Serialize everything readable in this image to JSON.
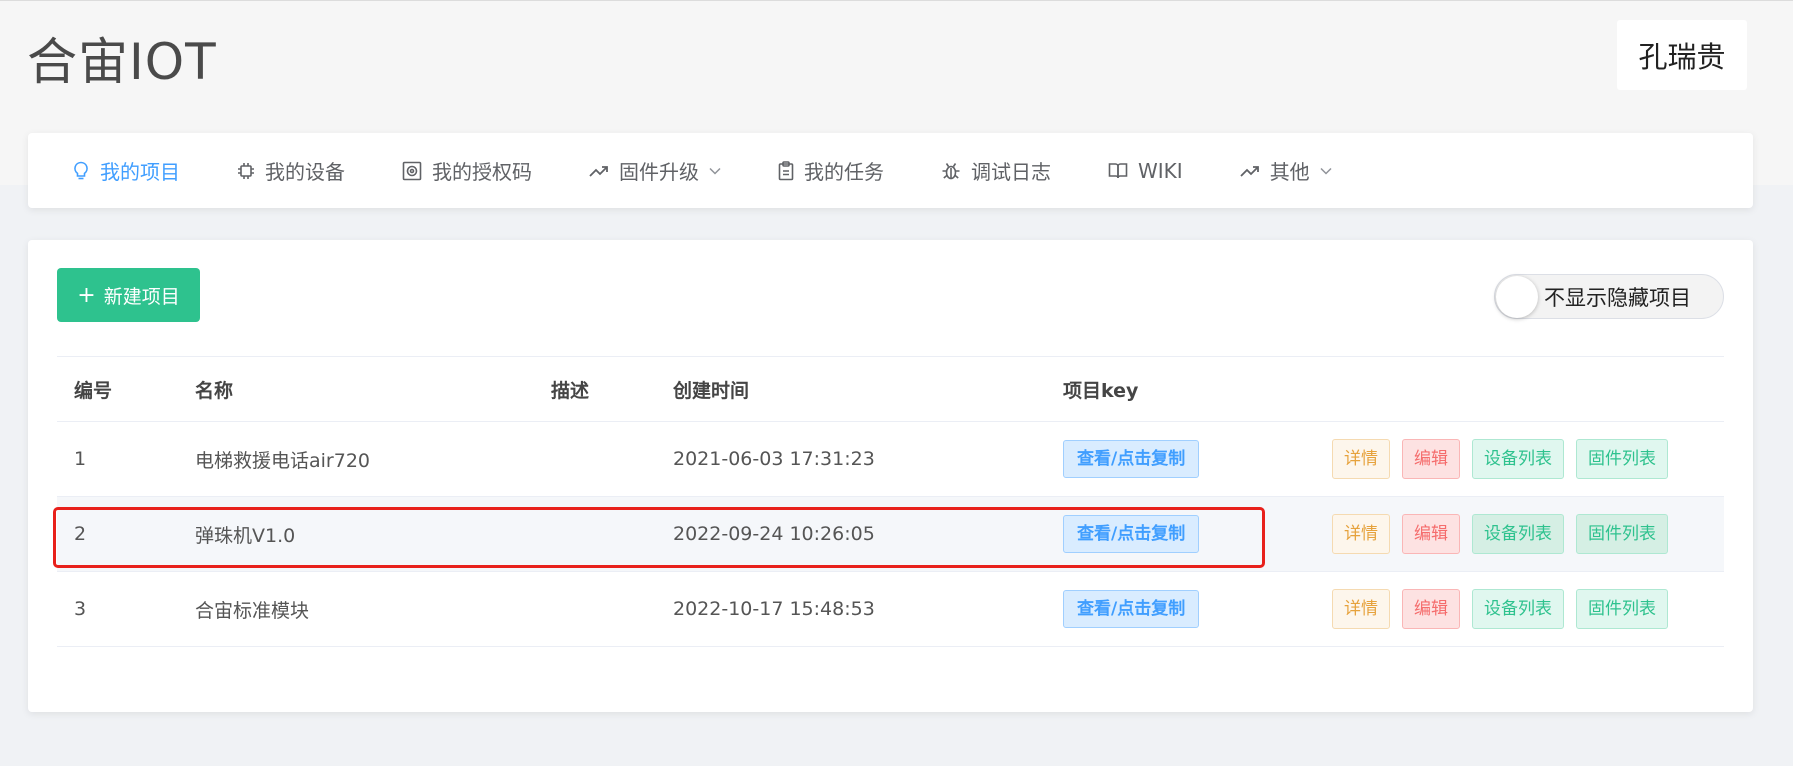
{
  "app": {
    "title": "合宙IOT",
    "user": "孔瑞贵"
  },
  "nav": [
    {
      "label": "我的项目",
      "icon": "lightbulb-icon",
      "active": true,
      "dropdown": false
    },
    {
      "label": "我的设备",
      "icon": "chip-icon",
      "active": false,
      "dropdown": false
    },
    {
      "label": "我的授权码",
      "icon": "qrcode-icon",
      "active": false,
      "dropdown": false
    },
    {
      "label": "固件升级",
      "icon": "trend-up-icon",
      "active": false,
      "dropdown": true
    },
    {
      "label": "我的任务",
      "icon": "clipboard-icon",
      "active": false,
      "dropdown": false
    },
    {
      "label": "调试日志",
      "icon": "bug-icon",
      "active": false,
      "dropdown": false
    },
    {
      "label": "WIKI",
      "icon": "book-icon",
      "active": false,
      "dropdown": false
    },
    {
      "label": "其他",
      "icon": "trend-up-icon",
      "active": false,
      "dropdown": true
    }
  ],
  "toolbar": {
    "new_project": "新建项目",
    "hide_toggle_label": "不显示隐藏项目",
    "hide_toggle_on": false
  },
  "table": {
    "headers": {
      "id": "编号",
      "name": "名称",
      "desc": "描述",
      "created": "创建时间",
      "key": "项目key"
    },
    "rows": [
      {
        "id": "1",
        "name": "电梯救援电话air720",
        "desc": "",
        "created": "2021-06-03 17:31:23",
        "key_btn": "查看/点击复制",
        "detail": "详情",
        "edit": "编辑",
        "devices": "设备列表",
        "firmware": "固件列表"
      },
      {
        "id": "2",
        "name": "弹珠机V1.0",
        "desc": "",
        "created": "2022-09-24 10:26:05",
        "key_btn": "查看/点击复制",
        "detail": "详情",
        "edit": "编辑",
        "devices": "设备列表",
        "firmware": "固件列表"
      },
      {
        "id": "3",
        "name": "合宙标准模块",
        "desc": "",
        "created": "2022-10-17 15:48:53",
        "key_btn": "查看/点击复制",
        "detail": "详情",
        "edit": "编辑",
        "devices": "设备列表",
        "firmware": "固件列表"
      }
    ]
  },
  "colors": {
    "accent": "#409eff",
    "primary_button": "#2ec28e",
    "highlight_border": "#e8201b"
  }
}
